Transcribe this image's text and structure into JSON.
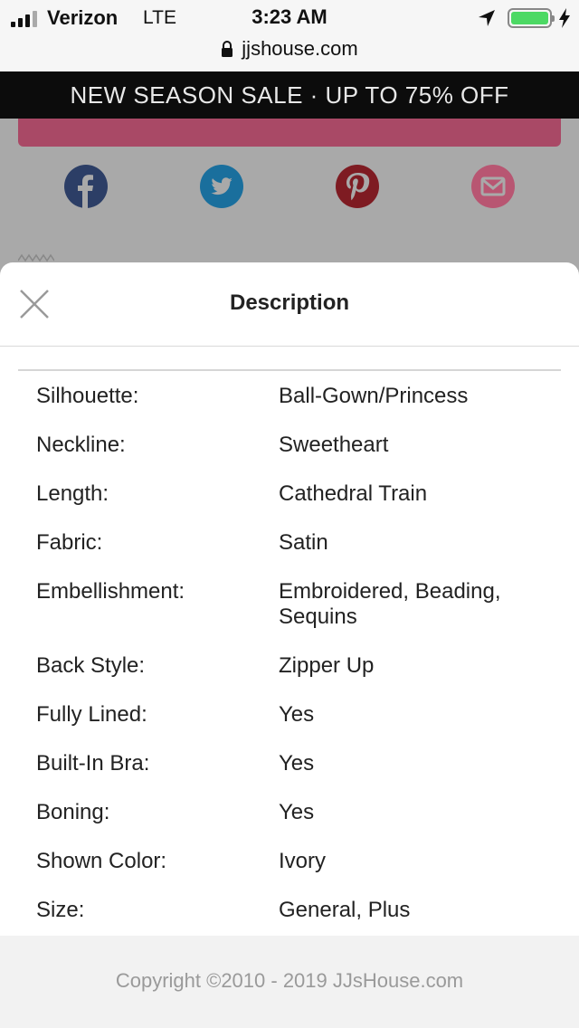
{
  "status_bar": {
    "carrier": "Verizon",
    "network": "LTE",
    "time": "3:23 AM",
    "signal_bars_filled": 3,
    "signal_bars_total": 4,
    "battery_level": 1.0,
    "battery_color": "#4cd964",
    "icons": [
      "location-arrow-icon",
      "battery-icon",
      "charging-bolt-icon"
    ]
  },
  "browser": {
    "url": "jjshouse.com",
    "icon": "lock-icon"
  },
  "promo_banner": {
    "text": "NEW SEASON SALE · UP TO 75% OFF"
  },
  "share": {
    "icons": [
      "facebook-icon",
      "twitter-icon",
      "pinterest-icon",
      "email-icon"
    ]
  },
  "sheet": {
    "title": "Description",
    "close_icon": "close-icon",
    "specs": [
      {
        "label": "Silhouette:",
        "value": "Ball-Gown/Princess"
      },
      {
        "label": "Neckline:",
        "value": "Sweetheart"
      },
      {
        "label": "Length:",
        "value": "Cathedral Train"
      },
      {
        "label": "Fabric:",
        "value": "Satin"
      },
      {
        "label": "Embellishment:",
        "value": "Embroidered, Beading, Sequins"
      },
      {
        "label": "Back Style:",
        "value": "Zipper Up"
      },
      {
        "label": "Fully Lined:",
        "value": "Yes"
      },
      {
        "label": "Built-In Bra:",
        "value": "Yes"
      },
      {
        "label": "Boning:",
        "value": "Yes"
      },
      {
        "label": "Shown Color:",
        "value": "Ivory"
      },
      {
        "label": "Size:",
        "value": "General, Plus"
      }
    ]
  },
  "footer": {
    "copyright": "Copyright ©2010 - 2019 JJsHouse.com"
  },
  "colors": {
    "promo_background": "#0c0c0c",
    "accent_pink": "#a94966",
    "facebook": "#3b5998",
    "twitter": "#1da1f2",
    "pinterest": "#bd081c",
    "email": "#d4577b"
  }
}
